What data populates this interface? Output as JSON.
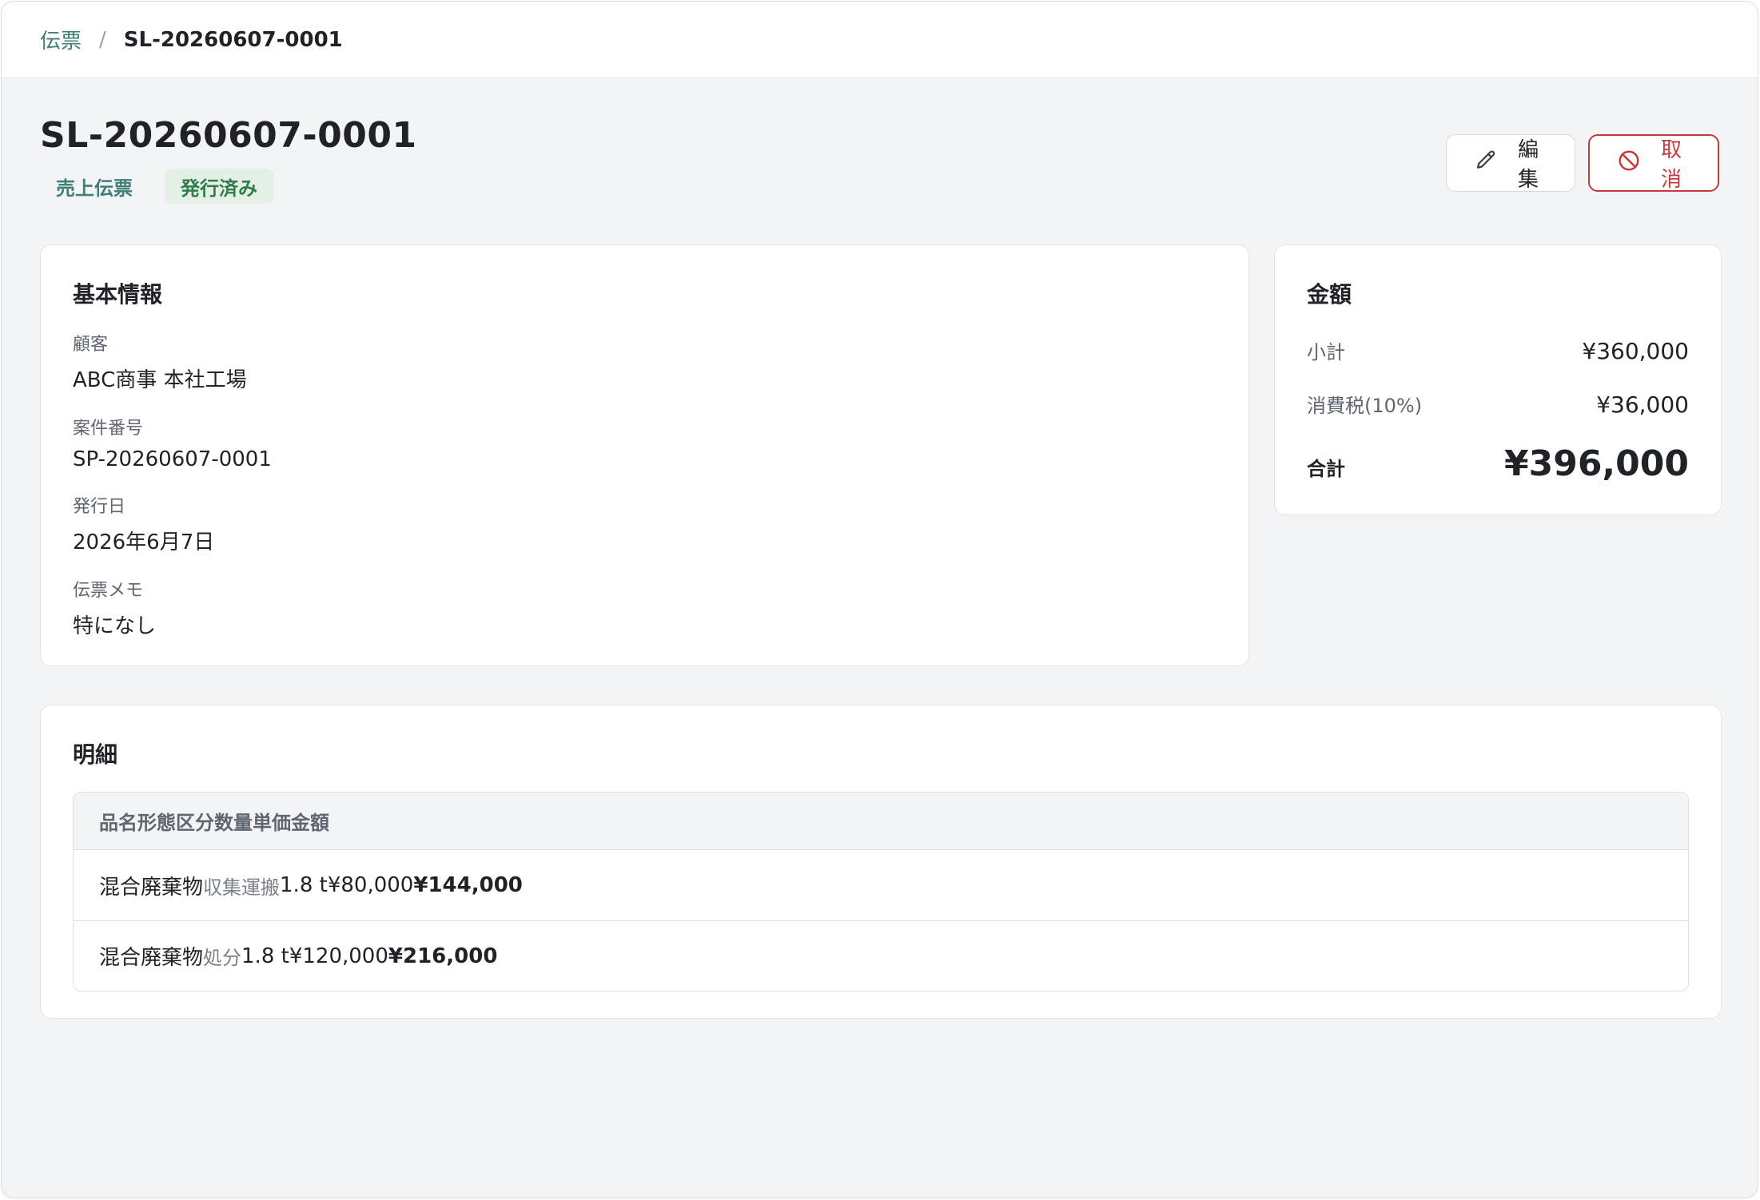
{
  "breadcrumb": {
    "parent": "伝票",
    "separator": "/",
    "current": "SL-20260607-0001"
  },
  "header": {
    "title": "SL-20260607-0001",
    "type_tag": "売上伝票",
    "status_tag": "発行済み",
    "edit_label": "編集",
    "cancel_label": "取消"
  },
  "info": {
    "title": "基本情報",
    "fields": [
      {
        "label": "顧客",
        "value": "ABC商事 本社工場"
      },
      {
        "label": "案件番号",
        "value": "SP-20260607-0001"
      },
      {
        "label": "発行日",
        "value": "2026年6月7日"
      },
      {
        "label": "伝票メモ",
        "value": "特になし"
      }
    ]
  },
  "amount": {
    "title": "金額",
    "subtotal_label": "小計",
    "subtotal": "¥360,000",
    "tax_label": "消費税(10%)",
    "tax": "¥36,000",
    "total_label": "合計",
    "total": "¥396,000"
  },
  "detail": {
    "title": "明細",
    "headers": [
      "品名",
      "形態区分",
      "数量",
      "単価",
      "金額"
    ],
    "rows": [
      {
        "name": "混合廃棄物",
        "category": "収集運搬",
        "qty": "1.8 t",
        "unit_price": "¥80,000",
        "amount": "¥144,000"
      },
      {
        "name": "混合廃棄物",
        "category": "処分",
        "qty": "1.8 t",
        "unit_price": "¥120,000",
        "amount": "¥216,000"
      }
    ]
  },
  "colors": {
    "accent": "#3f7f78",
    "danger": "#c43b3b",
    "success_bg": "#e4f0e6"
  }
}
